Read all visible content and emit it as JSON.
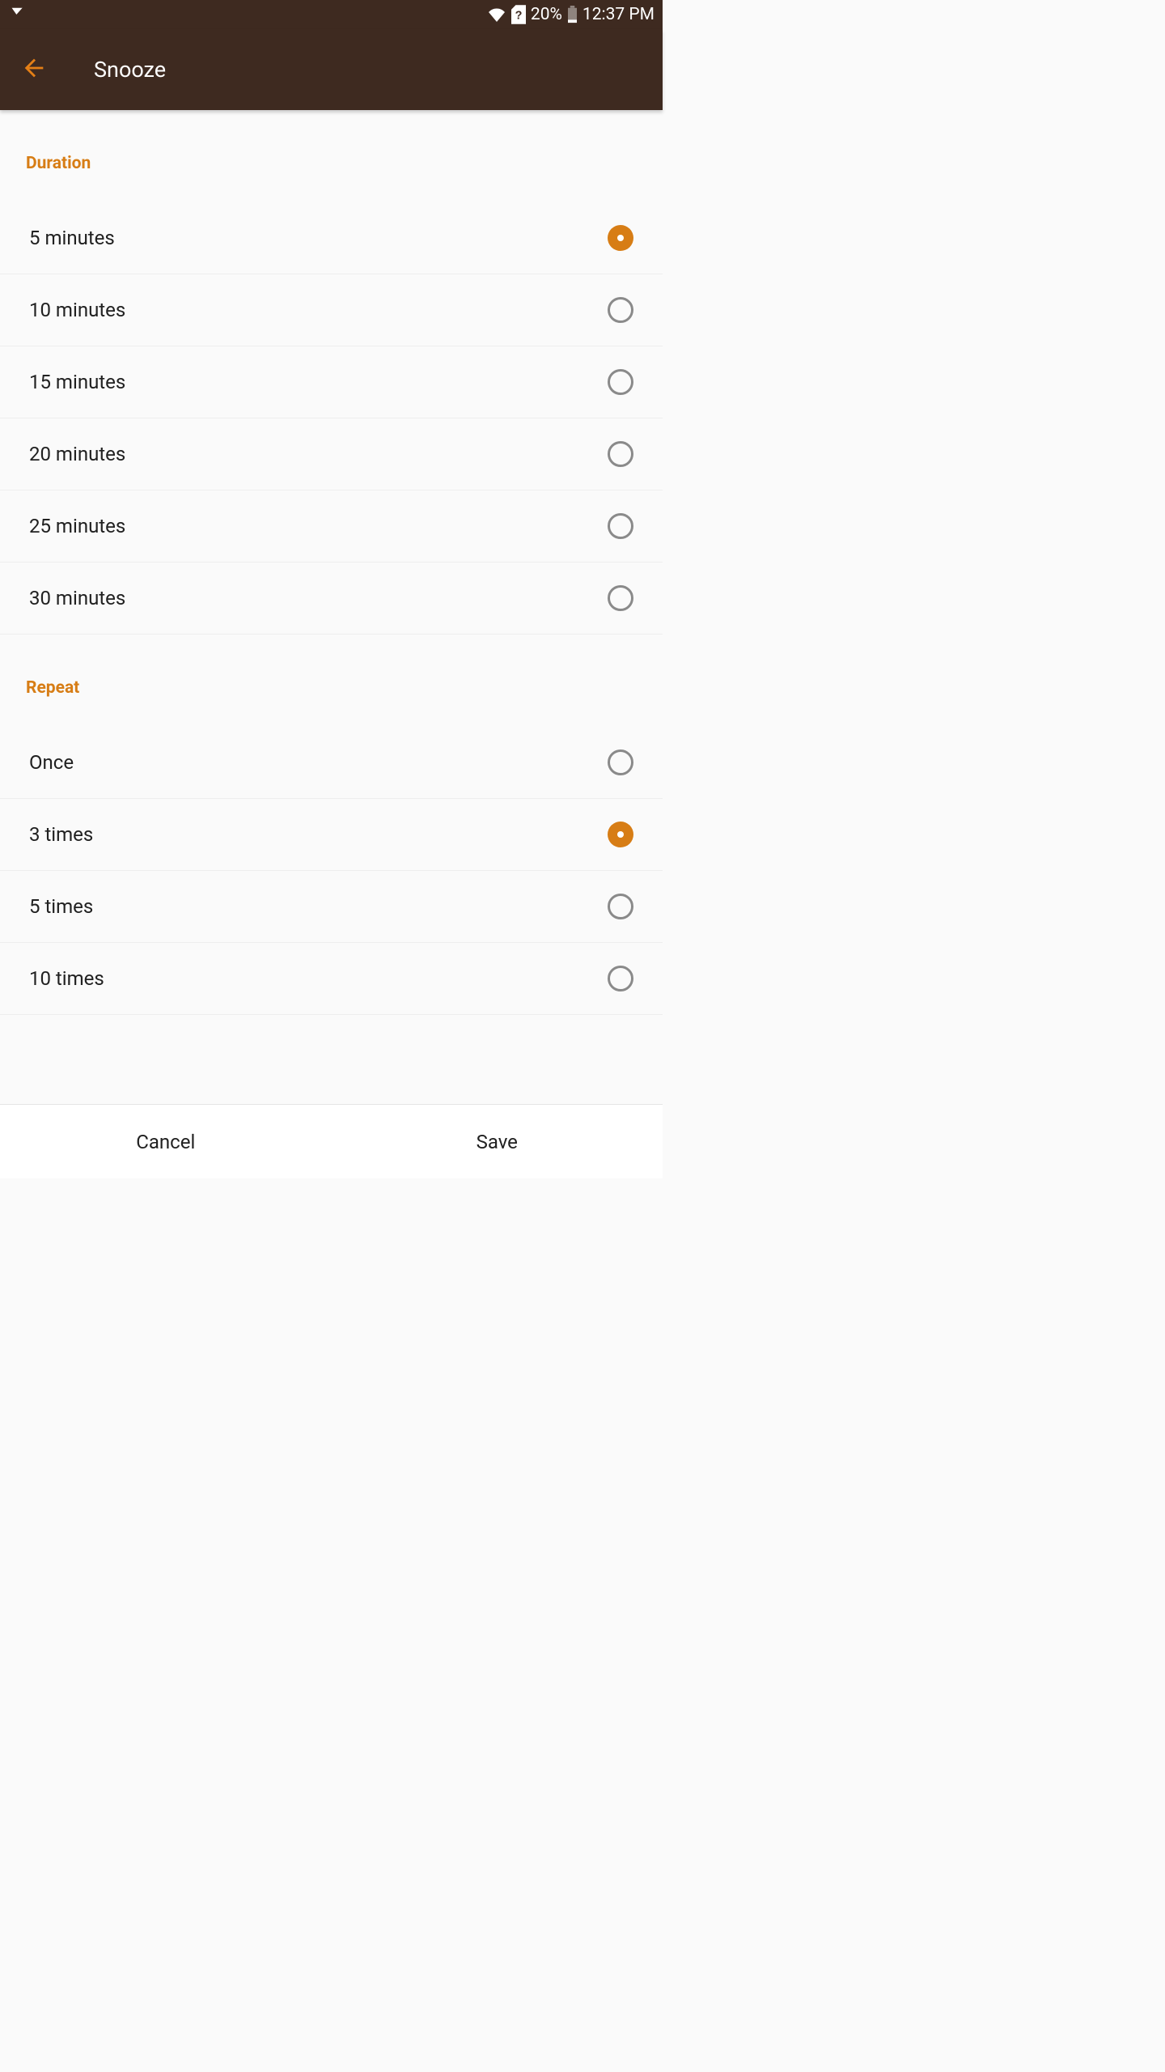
{
  "statusbar": {
    "battery_pct": "20%",
    "time": "12:37 PM"
  },
  "appbar": {
    "title": "Snooze"
  },
  "sections": {
    "duration": {
      "heading": "Duration",
      "items": [
        {
          "label": "5 minutes",
          "selected": true
        },
        {
          "label": "10 minutes",
          "selected": false
        },
        {
          "label": "15 minutes",
          "selected": false
        },
        {
          "label": "20 minutes",
          "selected": false
        },
        {
          "label": "25 minutes",
          "selected": false
        },
        {
          "label": "30 minutes",
          "selected": false
        }
      ]
    },
    "repeat": {
      "heading": "Repeat",
      "items": [
        {
          "label": "Once",
          "selected": false
        },
        {
          "label": "3 times",
          "selected": true
        },
        {
          "label": "5 times",
          "selected": false
        },
        {
          "label": "10 times",
          "selected": false
        }
      ]
    }
  },
  "footer": {
    "cancel": "Cancel",
    "save": "Save"
  },
  "colors": {
    "accent": "#d77d15",
    "appbar_bg": "#3e2a20"
  }
}
